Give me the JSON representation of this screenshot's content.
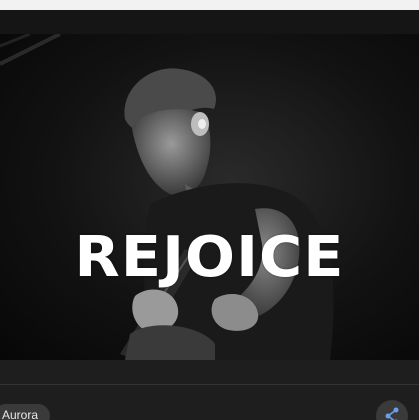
{
  "video": {
    "overlay_title": "REJOICE"
  },
  "bottom_bar": {
    "artist_chip_label": "Aurora",
    "share_icon": "share-icon"
  }
}
